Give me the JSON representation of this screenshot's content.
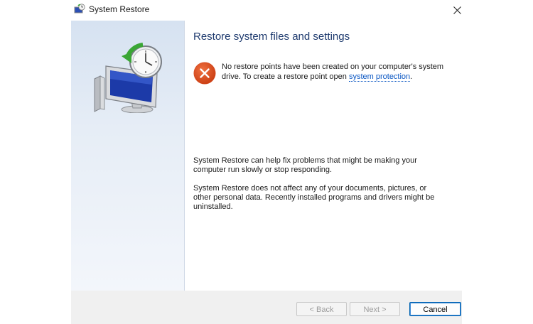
{
  "window": {
    "title": "System Restore",
    "close_glyph": "✕"
  },
  "content": {
    "heading": "Restore system files and settings",
    "error": {
      "text_before_link": "No restore points have been created on your computer's system drive. To create a restore point open ",
      "link_text": "system protection",
      "text_after_link": "."
    },
    "info_paragraphs": [
      "System Restore can help fix problems that might be making your computer run slowly or stop responding.",
      "System Restore does not affect any of your documents, pictures, or other personal data. Recently installed programs and drivers might be uninstalled."
    ]
  },
  "footer": {
    "back_label": "< Back",
    "next_label": "Next >",
    "cancel_label": "Cancel"
  },
  "colors": {
    "heading": "#1e3a6e",
    "link": "#0b57c3",
    "error_icon": "#d9461b",
    "cancel_border": "#0063b1"
  },
  "icons": [
    "system-restore-icon",
    "close-icon",
    "monitor-clock-icon",
    "error-icon"
  ]
}
